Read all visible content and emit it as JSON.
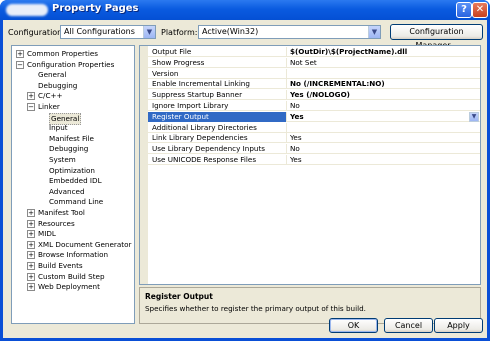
{
  "window": {
    "title": "Property Pages",
    "help_glyph": "?",
    "close_glyph": "✕"
  },
  "config_bar": {
    "configuration_label": "Configuration:",
    "configuration_value": "All Configurations",
    "platform_label": "Platform:",
    "platform_value": "Active(Win32)",
    "config_manager_label": "Configuration Manager...",
    "dropdown_glyph": "▼"
  },
  "tree": {
    "items": [
      {
        "label": "Common Properties",
        "expander": "+"
      },
      {
        "label": "Configuration Properties",
        "expander": "−"
      },
      {
        "label": "General",
        "expander": ""
      },
      {
        "label": "Debugging",
        "expander": ""
      },
      {
        "label": "C/C++",
        "expander": "+"
      },
      {
        "label": "Linker",
        "expander": "−"
      },
      {
        "label": "General",
        "expander": ""
      },
      {
        "label": "Input",
        "expander": ""
      },
      {
        "label": "Manifest File",
        "expander": ""
      },
      {
        "label": "Debugging",
        "expander": ""
      },
      {
        "label": "System",
        "expander": ""
      },
      {
        "label": "Optimization",
        "expander": ""
      },
      {
        "label": "Embedded IDL",
        "expander": ""
      },
      {
        "label": "Advanced",
        "expander": ""
      },
      {
        "label": "Command Line",
        "expander": ""
      },
      {
        "label": "Manifest Tool",
        "expander": "+"
      },
      {
        "label": "Resources",
        "expander": "+"
      },
      {
        "label": "MIDL",
        "expander": "+"
      },
      {
        "label": "XML Document Generator",
        "expander": "+"
      },
      {
        "label": "Browse Information",
        "expander": "+"
      },
      {
        "label": "Build Events",
        "expander": "+"
      },
      {
        "label": "Custom Build Step",
        "expander": "+"
      },
      {
        "label": "Web Deployment",
        "expander": "+"
      }
    ]
  },
  "properties": {
    "rows": [
      {
        "name": "Output File",
        "value": "$(OutDir)\\$(ProjectName).dll"
      },
      {
        "name": "Show Progress",
        "value": "Not Set"
      },
      {
        "name": "Version",
        "value": ""
      },
      {
        "name": "Enable Incremental Linking",
        "value": "No (/INCREMENTAL:NO)"
      },
      {
        "name": "Suppress Startup Banner",
        "value": "Yes (/NOLOGO)"
      },
      {
        "name": "Ignore Import Library",
        "value": "No"
      },
      {
        "name": "Register Output",
        "value": "Yes"
      },
      {
        "name": "Additional Library Directories",
        "value": ""
      },
      {
        "name": "Link Library Dependencies",
        "value": "Yes"
      },
      {
        "name": "Use Library Dependency Inputs",
        "value": "No"
      },
      {
        "name": "Use UNICODE Response Files",
        "value": "Yes"
      }
    ]
  },
  "description": {
    "title": "Register Output",
    "text": "Specifies whether to register the primary output of this build."
  },
  "buttons": {
    "ok": "OK",
    "cancel": "Cancel",
    "apply": "Apply"
  }
}
